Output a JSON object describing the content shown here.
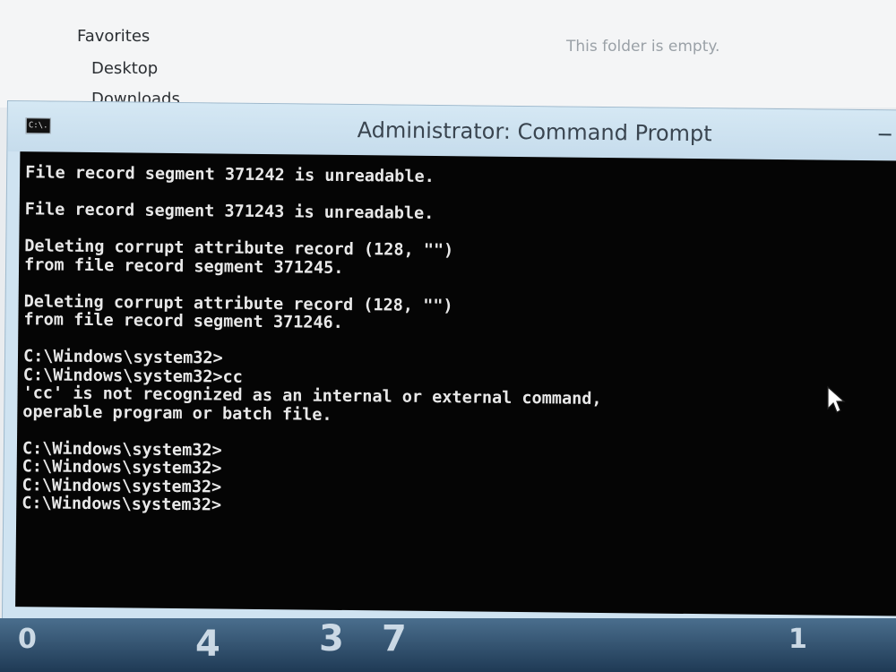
{
  "explorer": {
    "nav_items": [
      "Favorites",
      "Desktop",
      "Downloads"
    ],
    "empty_message": "This folder is empty."
  },
  "window": {
    "title": "Administrator: Command Prompt",
    "icon_text": "C:\\."
  },
  "console": {
    "lines": [
      "File record segment 371242 is unreadable.",
      "",
      "File record segment 371243 is unreadable.",
      "",
      "Deleting corrupt attribute record (128, \"\")",
      "from file record segment 371245.",
      "",
      "Deleting corrupt attribute record (128, \"\")",
      "from file record segment 371246.",
      "",
      "C:\\Windows\\system32>",
      "C:\\Windows\\system32>cc",
      "'cc' is not recognized as an internal or external command,",
      "operable program or batch file.",
      "",
      "C:\\Windows\\system32>",
      "C:\\Windows\\system32>",
      "C:\\Windows\\system32>",
      "C:\\Windows\\system32>"
    ]
  },
  "desktop_glyphs": [
    "4",
    "3",
    "7",
    "0",
    "1"
  ]
}
